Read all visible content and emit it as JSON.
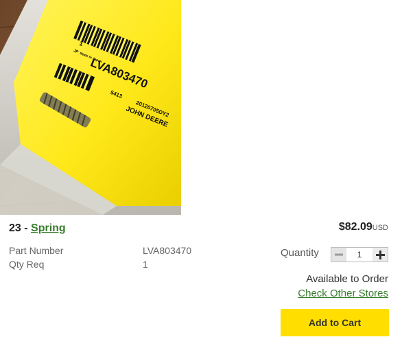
{
  "product": {
    "item_number": "23",
    "separator": "-",
    "name": "Spring",
    "photo": {
      "bag_label_lines": [
        "1",
        "JP",
        "Made in Japan",
        "LVA803470",
        "5413",
        "20120705DY2",
        "JOHN DEERE"
      ]
    }
  },
  "specs": [
    {
      "label": "Part Number",
      "value": "LVA803470"
    },
    {
      "label": "Qty Req",
      "value": "1"
    }
  ],
  "purchase": {
    "price": "$82.09",
    "currency": "USD",
    "quantity_label": "Quantity",
    "quantity_value": "1",
    "availability": "Available to Order",
    "check_stores_label": "Check Other Stores",
    "add_to_cart_label": "Add to Cart"
  },
  "colors": {
    "link_green": "#367c2b",
    "cart_yellow": "#ffde00"
  }
}
